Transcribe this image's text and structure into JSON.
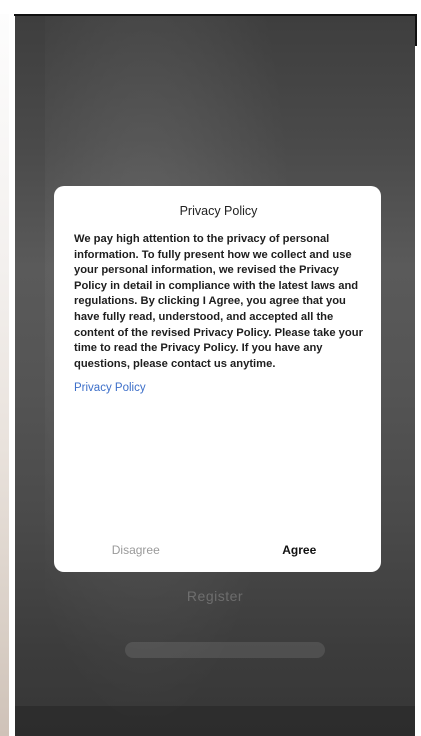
{
  "background": {
    "register_label": "Register"
  },
  "dialog": {
    "title": "Privacy Policy",
    "body": "We pay high attention to the privacy of personal information. To fully present how we collect and use your personal information, we revised the Privacy Policy in detail in compliance with the latest laws and regulations. By clicking I Agree, you agree that you have fully read, understood, and accepted all the content of the revised Privacy Policy. Please take your time to read the Privacy Policy. If you have any questions, please contact us anytime.",
    "link_label": "Privacy Policy",
    "disagree_label": "Disagree",
    "agree_label": "Agree"
  },
  "colors": {
    "link": "#3d6fc9",
    "disagree_text": "#9a9a9a",
    "agree_text": "#111111",
    "overlay": "#4a4a4a"
  }
}
